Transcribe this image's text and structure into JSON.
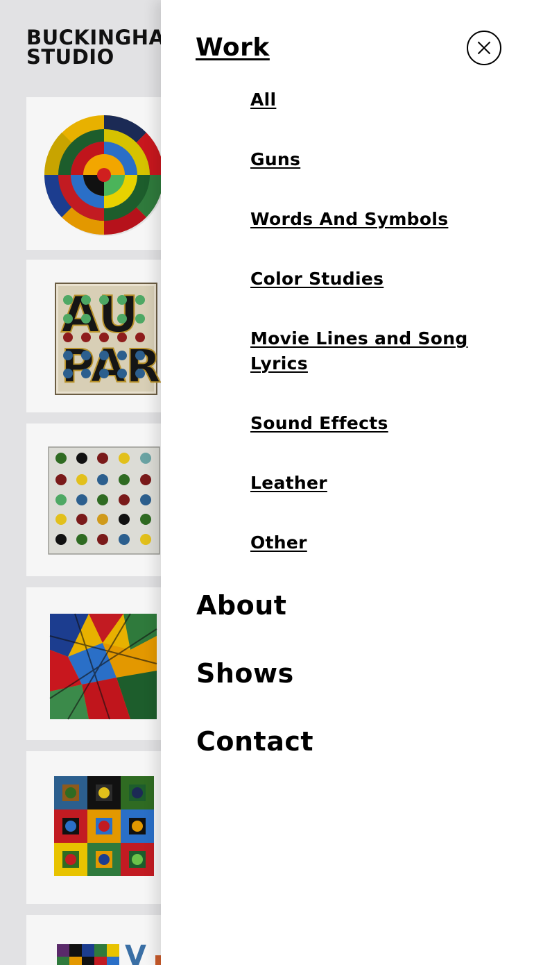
{
  "logo": {
    "line1": "BUCKINGHAM",
    "line2": "STUDIO"
  },
  "thumbnails": [
    {
      "name": "artwork-concentric-target"
    },
    {
      "name": "artwork-au-par"
    },
    {
      "name": "artwork-dot-grid"
    },
    {
      "name": "artwork-shards"
    },
    {
      "name": "artwork-squares-grid"
    },
    {
      "name": "artwork-partial"
    }
  ],
  "menu": {
    "work_label": "Work",
    "close_icon": "close-icon",
    "work_items": [
      {
        "label": "All"
      },
      {
        "label": "Guns"
      },
      {
        "label": "Words And Symbols"
      },
      {
        "label": "Color Studies"
      },
      {
        "label": "Movie Lines and Song Lyrics"
      },
      {
        "label": "Sound Effects"
      },
      {
        "label": "Leather"
      },
      {
        "label": "Other"
      }
    ],
    "about_label": "About",
    "shows_label": "Shows",
    "contact_label": "Contact"
  }
}
